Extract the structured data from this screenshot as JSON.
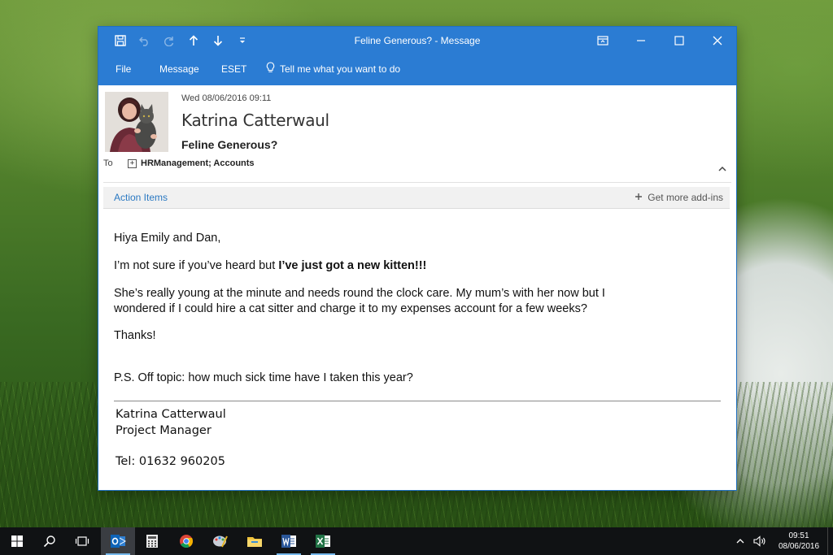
{
  "window": {
    "title": "Feline Generous? - Message",
    "ribbon_tabs": [
      "File",
      "Message",
      "ESET"
    ],
    "tell_me": "Tell me what you want to do"
  },
  "message": {
    "date": "Wed 08/06/2016 09:11",
    "sender": "Katrina Catterwaul",
    "subject": "Feline Generous?",
    "to_label": "To",
    "recipients": "HRManagement; Accounts"
  },
  "action_bar": {
    "action_items": "Action Items",
    "get_addins": "Get more add-ins"
  },
  "body": {
    "greeting": "Hiya Emily and Dan,",
    "line1_plain": "I’m not sure if you’ve heard but ",
    "line1_bold": "I’ve just got a new kitten!!!",
    "line2a": "She’s really young at the minute and needs round the clock care. My mum’s with her now but I",
    "line2b": "wondered if I could hire a cat sitter and charge it to my expenses account for a few weeks?",
    "thanks": "Thanks!",
    "ps": "P.S. Off topic: how much sick time have I taken this year?"
  },
  "signature": {
    "name": "Katrina Catterwaul",
    "role": "Project Manager",
    "tel": "Tel: 01632 960205"
  },
  "taskbar": {
    "icons": [
      "windows-start-icon",
      "search-icon",
      "task-view-icon",
      "outlook-icon",
      "calculator-icon",
      "chrome-icon",
      "paint-icon",
      "file-explorer-icon",
      "word-icon",
      "excel-icon"
    ],
    "time": "09:51",
    "date": "08/06/2016"
  },
  "colors": {
    "titlebar": "#2b7cd3",
    "link": "#2b79c2",
    "taskbar": "#101214"
  }
}
